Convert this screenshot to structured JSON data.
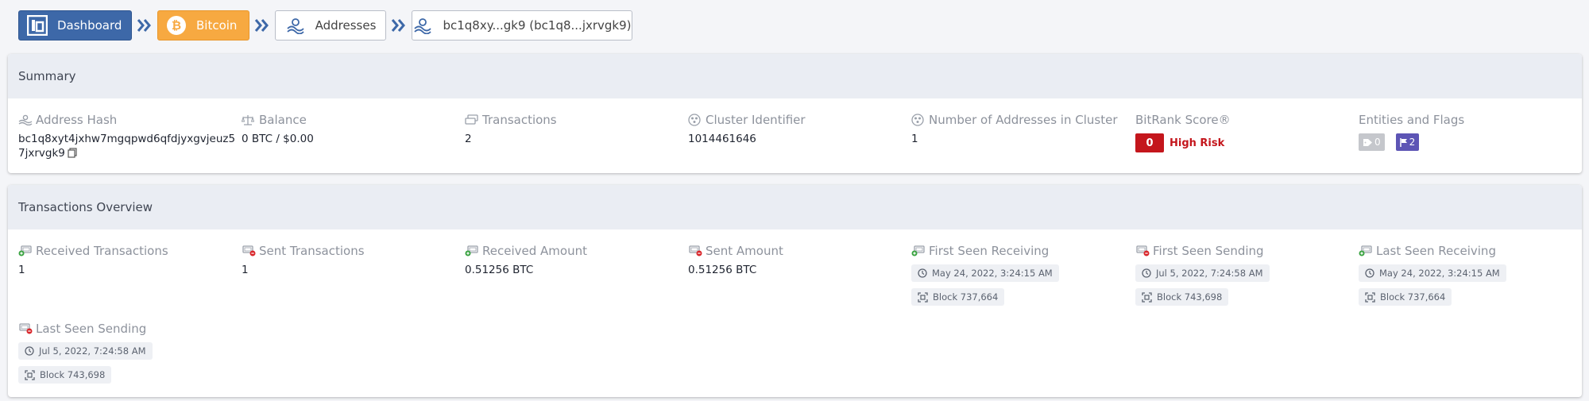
{
  "breadcrumb": {
    "dashboard": "Dashboard",
    "bitcoin": "Bitcoin",
    "addresses": "Addresses",
    "current": "bc1q8xy...gk9 (bc1q8...jxrvgk9)"
  },
  "summary": {
    "title": "Summary",
    "address_hash": {
      "label": "Address Hash",
      "value": "bc1q8xyt4jxhw7mgqpwd6qfdjyxgvjeuz57jxrvgk9"
    },
    "balance": {
      "label": "Balance",
      "value": "0 BTC / $0.00"
    },
    "transactions": {
      "label": "Transactions",
      "value": "2"
    },
    "cluster_identifier": {
      "label": "Cluster Identifier",
      "value": "1014461646"
    },
    "addresses_in_cluster": {
      "label": "Number of Addresses in Cluster",
      "value": "1"
    },
    "bitrank": {
      "label": "BitRank Score®",
      "score": "0",
      "risk": "High Risk"
    },
    "entities_flags": {
      "label": "Entities and Flags",
      "entities": "0",
      "flags": "2"
    }
  },
  "overview": {
    "title": "Transactions Overview",
    "received_tx": {
      "label": "Received Transactions",
      "value": "1"
    },
    "sent_tx": {
      "label": "Sent Transactions",
      "value": "1"
    },
    "received_amount": {
      "label": "Received Amount",
      "value": "0.51256 BTC"
    },
    "sent_amount": {
      "label": "Sent Amount",
      "value": "0.51256 BTC"
    },
    "first_seen_receiving": {
      "label": "First Seen Receiving",
      "date": "May 24, 2022, 3:24:15 AM",
      "block": "Block 737,664"
    },
    "first_seen_sending": {
      "label": "First Seen Sending",
      "date": "Jul 5, 2022, 7:24:58 AM",
      "block": "Block 743,698"
    },
    "last_seen_receiving": {
      "label": "Last Seen Receiving",
      "date": "May 24, 2022, 3:24:15 AM",
      "block": "Block 737,664"
    },
    "last_seen_sending": {
      "label": "Last Seen Sending",
      "date": "Jul 5, 2022, 7:24:58 AM",
      "block": "Block 743,698"
    }
  },
  "colors": {
    "dashboard_blue": "#3d68a8",
    "bitcoin_orange": "#f7a941",
    "risk_red": "#c4161c",
    "flag_purple": "#5d55b5"
  }
}
